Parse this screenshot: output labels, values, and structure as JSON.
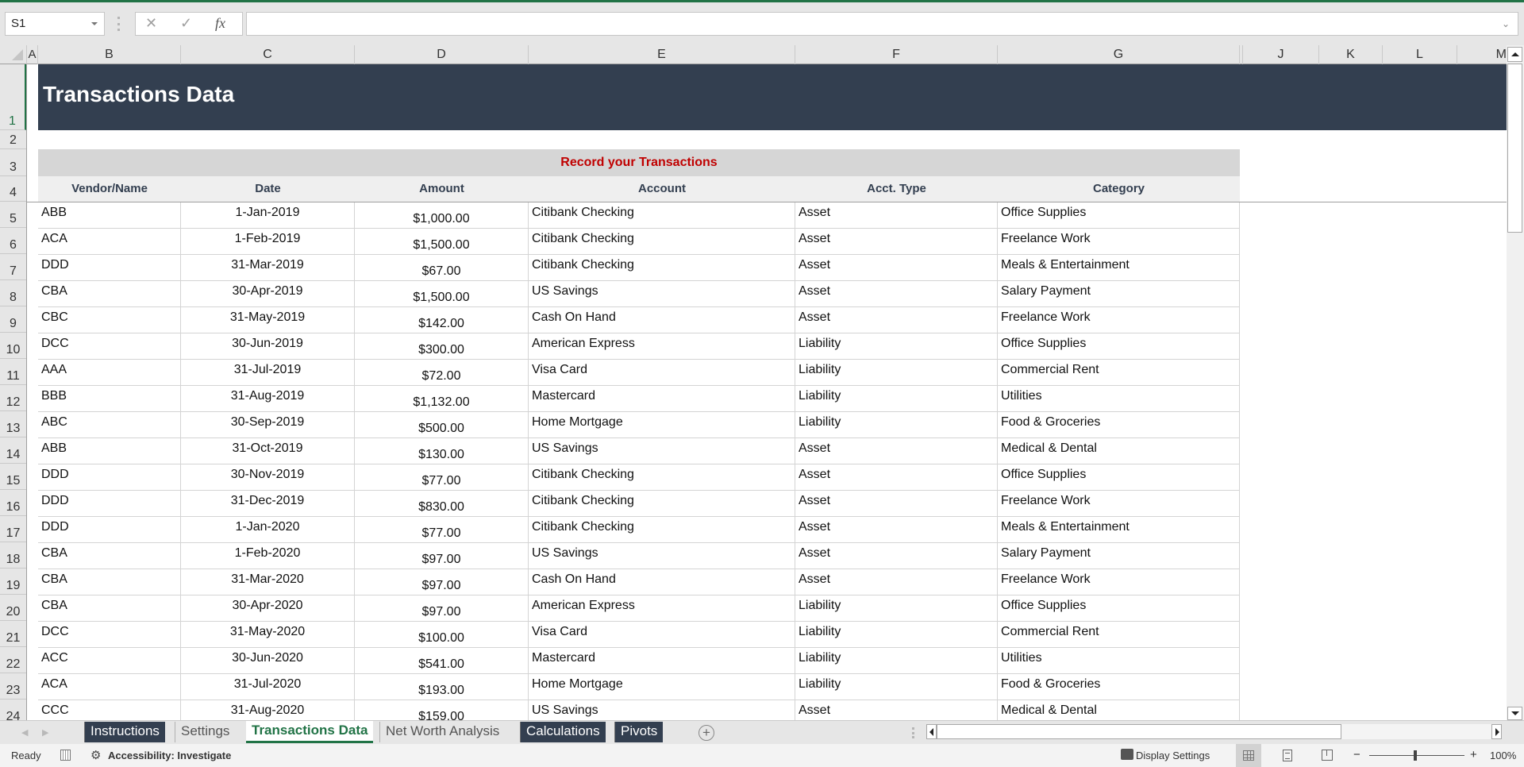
{
  "formula_bar": {
    "name_box": "S1",
    "cancel_icon": "✕",
    "enter_icon": "✓",
    "fx_icon": "fx",
    "formula": ""
  },
  "columns": [
    {
      "id": "A",
      "label": "A"
    },
    {
      "id": "B",
      "label": "B"
    },
    {
      "id": "C",
      "label": "C"
    },
    {
      "id": "D",
      "label": "D"
    },
    {
      "id": "E",
      "label": "E"
    },
    {
      "id": "F",
      "label": "F"
    },
    {
      "id": "G",
      "label": "G"
    },
    {
      "id": "J",
      "label": "J"
    },
    {
      "id": "K",
      "label": "K"
    },
    {
      "id": "L",
      "label": "L"
    },
    {
      "id": "M",
      "label": "M"
    }
  ],
  "row_numbers": [
    "1",
    "2",
    "3",
    "4",
    "5",
    "6",
    "7",
    "8",
    "9",
    "10",
    "11",
    "12",
    "13",
    "14",
    "15",
    "16",
    "17",
    "18",
    "19",
    "20",
    "21",
    "22",
    "23",
    "24"
  ],
  "sheet": {
    "title": "Transactions Data",
    "section_title": "Record your Transactions",
    "headers": [
      "Vendor/Name",
      "Date",
      "Amount",
      "Account",
      "Acct. Type",
      "Category"
    ],
    "rows": [
      [
        "ABB",
        "1-Jan-2019",
        "$1,000.00",
        "Citibank Checking",
        "Asset",
        "Office Supplies"
      ],
      [
        "ACA",
        "1-Feb-2019",
        "$1,500.00",
        "Citibank Checking",
        "Asset",
        "Freelance Work"
      ],
      [
        "DDD",
        "31-Mar-2019",
        "$67.00",
        "Citibank Checking",
        "Asset",
        "Meals & Entertainment"
      ],
      [
        "CBA",
        "30-Apr-2019",
        "$1,500.00",
        "US Savings",
        "Asset",
        "Salary Payment"
      ],
      [
        "CBC",
        "31-May-2019",
        "$142.00",
        "Cash On Hand",
        "Asset",
        "Freelance Work"
      ],
      [
        "DCC",
        "30-Jun-2019",
        "$300.00",
        "American Express",
        "Liability",
        "Office Supplies"
      ],
      [
        "AAA",
        "31-Jul-2019",
        "$72.00",
        "Visa Card",
        "Liability",
        "Commercial Rent"
      ],
      [
        "BBB",
        "31-Aug-2019",
        "$1,132.00",
        "Mastercard",
        "Liability",
        "Utilities"
      ],
      [
        "ABC",
        "30-Sep-2019",
        "$500.00",
        "Home Mortgage",
        "Liability",
        "Food & Groceries"
      ],
      [
        "ABB",
        "31-Oct-2019",
        "$130.00",
        "US Savings",
        "Asset",
        "Medical & Dental"
      ],
      [
        "DDD",
        "30-Nov-2019",
        "$77.00",
        "Citibank Checking",
        "Asset",
        "Office Supplies"
      ],
      [
        "DDD",
        "31-Dec-2019",
        "$830.00",
        "Citibank Checking",
        "Asset",
        "Freelance Work"
      ],
      [
        "DDD",
        "1-Jan-2020",
        "$77.00",
        "Citibank Checking",
        "Asset",
        "Meals & Entertainment"
      ],
      [
        "CBA",
        "1-Feb-2020",
        "$97.00",
        "US Savings",
        "Asset",
        "Salary Payment"
      ],
      [
        "CBA",
        "31-Mar-2020",
        "$97.00",
        "Cash On Hand",
        "Asset",
        "Freelance Work"
      ],
      [
        "CBA",
        "30-Apr-2020",
        "$97.00",
        "American Express",
        "Liability",
        "Office Supplies"
      ],
      [
        "DCC",
        "31-May-2020",
        "$100.00",
        "Visa Card",
        "Liability",
        "Commercial Rent"
      ],
      [
        "ACC",
        "30-Jun-2020",
        "$541.00",
        "Mastercard",
        "Liability",
        "Utilities"
      ],
      [
        "ACA",
        "31-Jul-2020",
        "$193.00",
        "Home Mortgage",
        "Liability",
        "Food & Groceries"
      ],
      [
        "CCC",
        "31-Aug-2020",
        "$159.00",
        "US Savings",
        "Asset",
        "Medical & Dental"
      ]
    ]
  },
  "tabs": [
    {
      "label": "Instructions",
      "style": "dark",
      "active": false
    },
    {
      "label": "Settings",
      "style": "light",
      "active": false
    },
    {
      "label": "Transactions Data",
      "style": "light",
      "active": true
    },
    {
      "label": "Net Worth Analysis",
      "style": "light",
      "active": false
    },
    {
      "label": "Calculations",
      "style": "dark",
      "active": false
    },
    {
      "label": "Pivots",
      "style": "dark",
      "active": false
    }
  ],
  "tab_nav": {
    "prev": "◀",
    "next": "▶",
    "add": "+"
  },
  "status_bar": {
    "ready": "Ready",
    "accessibility": "Accessibility: Investigate",
    "display_settings": "Display Settings",
    "zoom_minus": "−",
    "zoom_plus": "+",
    "zoom_level": "100%"
  },
  "colors": {
    "excel_green": "#217346",
    "title_band": "#333f50",
    "section_title_red": "#c00000"
  }
}
